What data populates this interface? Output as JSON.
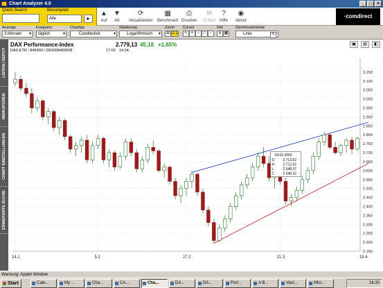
{
  "window": {
    "title": "Chart Analyzer 4.0",
    "buttons": [
      "_",
      "□",
      "×"
    ]
  },
  "toolbar": {
    "quick_search_label": "Quick Search",
    "quick_search_value": "",
    "boersenplatz_label": "Börsenplatz",
    "boersenplatz_value": "Alle",
    "go_label": "▸",
    "tools": [
      {
        "label": "Auf",
        "icon": "up-arrow-icon",
        "glyph": "▲",
        "enabled": true
      },
      {
        "label": "Ab",
        "icon": "down-arrow-icon",
        "glyph": "▼",
        "enabled": true
      },
      {
        "label": "Aktualisieren",
        "icon": "refresh-icon",
        "glyph": "⟳",
        "enabled": true
      },
      {
        "label": "Benchmark",
        "icon": "benchmark-chart-icon",
        "glyph": "▦",
        "enabled": true
      },
      {
        "label": "Drucken",
        "icon": "printer-icon",
        "glyph": "⎙",
        "enabled": true
      },
      {
        "label": "E-Mail",
        "icon": "mail-icon",
        "glyph": "✉",
        "enabled": false
      },
      {
        "label": "Hilfe",
        "icon": "help-icon",
        "glyph": "?",
        "enabled": true
      },
      {
        "label": "About",
        "icon": "about-icon",
        "glyph": "◉",
        "enabled": true
      }
    ],
    "brand": "·comdirect"
  },
  "options": {
    "anzeige_label": "Anzeige",
    "anzeige_value": "3 Monate",
    "frequenz_label": "Frequenz",
    "frequenz_value": "täglich",
    "charttyp_label": "Charttyp",
    "charttyp_value": "Candlestick",
    "skalierung_label": "Skalierung",
    "skalierung_value": "Logarithmisch",
    "zoom_label": "Zoom",
    "zoom_value": "1:1",
    "cursor_label": "Cursor",
    "info_label": "Info",
    "zeichen_label": "Zeichenelemente",
    "zeichen_value": "Linie"
  },
  "leftnav": [
    "LISTEN / DEPOT",
    "INDIKATOREN",
    "CHART EINSTELLUNGEN",
    "ERWEITERTE SUCHE"
  ],
  "instrument": {
    "name": "DAX Performance-Index",
    "ids": "DAX.ETR / 846900 / DE0008469008",
    "price": "2.779,13",
    "change": "45,18",
    "pct": "+1,65%",
    "time": "17:02",
    "date": "14.04."
  },
  "chart_data": {
    "type": "candlestick",
    "title": "DAX Performance-Index",
    "ylim": [
      2150,
      3200
    ],
    "yticks": [
      3150,
      3100,
      3050,
      3000,
      2950,
      2900,
      2850,
      2800,
      2750,
      2700,
      2650,
      2600,
      2550,
      2500,
      2450,
      2400,
      2350,
      2300,
      2250,
      2200,
      2150
    ],
    "ytick_labels": [
      "3.150",
      "3.100",
      "3.050",
      "3.000",
      "2.950",
      "2.900",
      "2.850",
      "2.800",
      "2.750",
      "2.700",
      "2.650",
      "2.600",
      "2.550",
      "2.500",
      "2.450",
      "2.400",
      "2.350",
      "2.300",
      "2.250",
      "2.200",
      "2.150"
    ],
    "xticks": [
      {
        "label": "14.1",
        "index": 0
      },
      {
        "label": "5.2",
        "index": 15
      },
      {
        "label": "27.2",
        "index": 31
      },
      {
        "label": "21.3",
        "index": 48
      },
      {
        "label": "15.4",
        "index": 63
      }
    ],
    "candles": [
      [
        3090,
        3150,
        3070,
        3110
      ],
      [
        3110,
        3130,
        3040,
        3060
      ],
      [
        3060,
        3090,
        3010,
        3030
      ],
      [
        3030,
        3060,
        2920,
        2950
      ],
      [
        2950,
        3010,
        2930,
        2990
      ],
      [
        2990,
        3000,
        2880,
        2900
      ],
      [
        2900,
        2950,
        2860,
        2930
      ],
      [
        2930,
        2940,
        2820,
        2840
      ],
      [
        2840,
        2900,
        2800,
        2880
      ],
      [
        2880,
        2890,
        2770,
        2790
      ],
      [
        2790,
        2800,
        2700,
        2720
      ],
      [
        2720,
        2760,
        2680,
        2740
      ],
      [
        2740,
        2790,
        2700,
        2770
      ],
      [
        2770,
        2800,
        2640,
        2660
      ],
      [
        2660,
        2760,
        2640,
        2740
      ],
      [
        2740,
        2800,
        2720,
        2780
      ],
      [
        2780,
        2790,
        2640,
        2660
      ],
      [
        2660,
        2720,
        2620,
        2700
      ],
      [
        2700,
        2710,
        2600,
        2620
      ],
      [
        2620,
        2700,
        2610,
        2680
      ],
      [
        2680,
        2780,
        2660,
        2760
      ],
      [
        2760,
        2780,
        2680,
        2700
      ],
      [
        2700,
        2720,
        2590,
        2610
      ],
      [
        2610,
        2680,
        2590,
        2660
      ],
      [
        2660,
        2750,
        2640,
        2730
      ],
      [
        2730,
        2770,
        2690,
        2710
      ],
      [
        2710,
        2720,
        2590,
        2600
      ],
      [
        2600,
        2640,
        2560,
        2620
      ],
      [
        2620,
        2630,
        2520,
        2540
      ],
      [
        2540,
        2560,
        2440,
        2460
      ],
      [
        2460,
        2520,
        2420,
        2500
      ],
      [
        2500,
        2560,
        2460,
        2540
      ],
      [
        2540,
        2600,
        2500,
        2580
      ],
      [
        2580,
        2590,
        2460,
        2480
      ],
      [
        2480,
        2500,
        2360,
        2380
      ],
      [
        2380,
        2400,
        2290,
        2310
      ],
      [
        2310,
        2330,
        2190,
        2210
      ],
      [
        2210,
        2300,
        2200,
        2280
      ],
      [
        2280,
        2350,
        2260,
        2330
      ],
      [
        2330,
        2420,
        2310,
        2400
      ],
      [
        2400,
        2480,
        2380,
        2460
      ],
      [
        2460,
        2540,
        2440,
        2520
      ],
      [
        2520,
        2580,
        2500,
        2560
      ],
      [
        2560,
        2640,
        2540,
        2620
      ],
      [
        2620,
        2700,
        2600,
        2680
      ],
      [
        2680,
        2730,
        2620,
        2640
      ],
      [
        2640,
        2680,
        2540,
        2560
      ],
      [
        2560,
        2600,
        2500,
        2580
      ],
      [
        2580,
        2620,
        2520,
        2540
      ],
      [
        2540,
        2560,
        2410,
        2430
      ],
      [
        2430,
        2470,
        2400,
        2450
      ],
      [
        2450,
        2510,
        2430,
        2490
      ],
      [
        2490,
        2570,
        2470,
        2550
      ],
      [
        2550,
        2620,
        2530,
        2600
      ],
      [
        2600,
        2700,
        2580,
        2680
      ],
      [
        2680,
        2780,
        2660,
        2760
      ],
      [
        2760,
        2820,
        2740,
        2800
      ],
      [
        2800,
        2810,
        2720,
        2730
      ],
      [
        2730,
        2760,
        2690,
        2700
      ],
      [
        2700,
        2750,
        2680,
        2740
      ],
      [
        2740,
        2780,
        2700,
        2770
      ],
      [
        2770,
        2790,
        2690,
        2720
      ],
      [
        2720,
        2790,
        2710,
        2779
      ]
    ],
    "info_box": {
      "date": "24.03.2003",
      "rows": [
        [
          "O",
          "2.713,62"
        ],
        [
          "H",
          "2.712,62"
        ],
        [
          "L",
          "2.548,37"
        ],
        [
          "C",
          "2.548,32"
        ]
      ]
    },
    "trendlines": [
      {
        "color": "#2040c0",
        "from": [
          32,
          2590
        ],
        "to": [
          64,
          2870
        ]
      },
      {
        "color": "#d02020",
        "from": [
          36,
          2195
        ],
        "to": [
          64,
          2640
        ]
      }
    ]
  },
  "status": {
    "text": "Warnung: Applet Window"
  },
  "taskbar": {
    "start": "Start",
    "tasks": [
      {
        "label": "Cale...",
        "active": false
      },
      {
        "label": "My ...",
        "active": false
      },
      {
        "label": "Cha...",
        "active": false
      },
      {
        "label": "CA...",
        "active": false
      },
      {
        "label": "Cha...",
        "active": true
      },
      {
        "label": "DA...",
        "active": false
      },
      {
        "label": "DA...",
        "active": false
      },
      {
        "label": "Port...",
        "active": false
      },
      {
        "label": "A B...",
        "active": false
      },
      {
        "label": "Vast...",
        "active": false
      },
      {
        "label": "Micr...",
        "active": false
      }
    ],
    "clock": "16:20"
  },
  "colors": {
    "up": "#ffffff",
    "down": "#a01818",
    "wick": "#1a7a1a"
  }
}
